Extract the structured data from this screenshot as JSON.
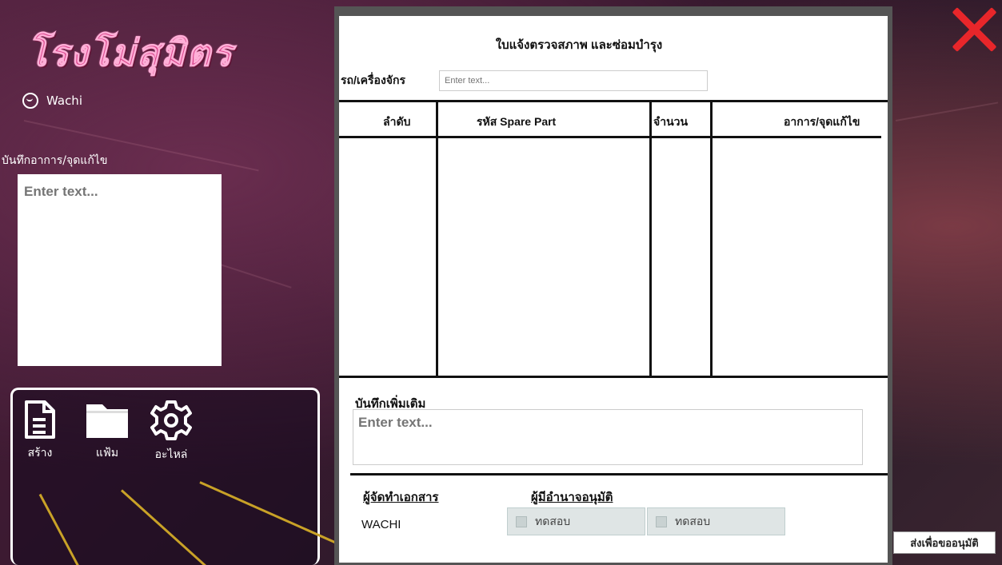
{
  "app": {
    "logo_text": "โรงโม่สุมิตร",
    "user_name": "Wachi"
  },
  "sidebar": {
    "note_label": "บันทึกอาการ/จุดแก้ไข",
    "note_placeholder": "Enter text...",
    "tools": [
      {
        "label": "สร้าง",
        "icon": "document-icon"
      },
      {
        "label": "แฟ้ม",
        "icon": "folder-icon"
      },
      {
        "label": "อะไหล่",
        "icon": "gear-icon"
      }
    ]
  },
  "form": {
    "title": "ใบแจ้งตรวจสภาพ และซ่อมบำรุง",
    "machine_label": "รถ/เครื่องจักร",
    "machine_placeholder": "Enter text...",
    "columns": [
      "ลำดับ",
      "รหัส Spare Part",
      "จำนวน",
      "อาการ/จุดแก้ไข"
    ],
    "extra_label": "บันทึกเพิ่มเติม",
    "extra_placeholder": "Enter text...",
    "preparer_label": "ผู้จัดทำเอกสาร",
    "approver_label": "ผู้มีอำนาจอนุมัติ",
    "preparer_name": "WACHI",
    "approvers": [
      "ทดสอบ",
      "ทดสอบ"
    ]
  },
  "actions": {
    "submit_label": "ส่งเพื่อขออนุมัติ",
    "close_icon": "close-icon"
  },
  "colors": {
    "accent_close": "#e8262a",
    "logo": "#d8468c",
    "pointer_lines": "#c9a227"
  }
}
